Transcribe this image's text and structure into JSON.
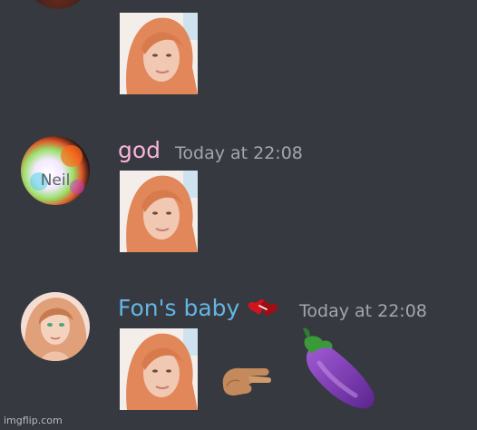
{
  "messages": [
    {
      "username": "",
      "timestamp": "",
      "attachment": "selfie-photo"
    },
    {
      "username": "god",
      "username_color": "#f7b4d8",
      "timestamp": "Today at 22:08",
      "avatar_text": "Neil",
      "attachment": "selfie-photo"
    },
    {
      "username": "Fon's baby",
      "username_color": "#64b5e4",
      "badge_icon": "red-hearts-badge-icon",
      "timestamp": "Today at 22:08",
      "attachment": "selfie-photo",
      "emojis": [
        "pinching-hand-icon",
        "eggplant-icon"
      ]
    }
  ],
  "watermark": "imgflip.com",
  "colors": {
    "background": "#36393f",
    "timestamp": "#a3a6ab"
  }
}
